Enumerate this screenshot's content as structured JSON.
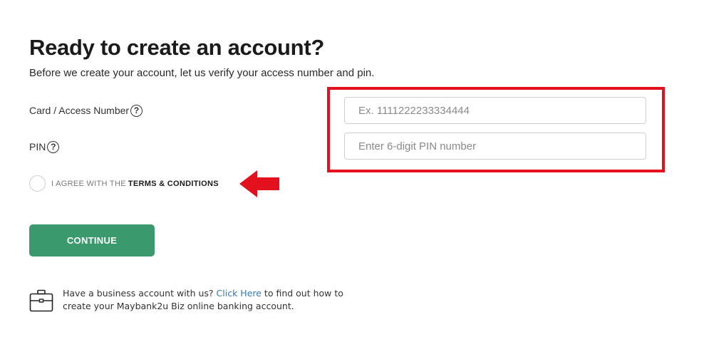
{
  "header": {
    "title": "Ready to create an account?",
    "subtitle": "Before we create your account, let us verify your access number and pin."
  },
  "form": {
    "card_label": "Card / Access Number",
    "card_placeholder": "Ex. 1111222233334444",
    "pin_label": "PIN",
    "pin_placeholder": "Enter 6-digit PIN number",
    "help_symbol": "?",
    "agree_prefix": "I AGREE WITH THE",
    "agree_terms": "TERMS & CONDITIONS",
    "agree_checked": false,
    "continue_label": "CONTINUE"
  },
  "business": {
    "text_before": "Have a business account with us?",
    "link_text": "Click Here",
    "text_after": "to find out how to",
    "text_line2": "create your Maybank2u Biz online banking account."
  },
  "icons": {
    "help": "question-circle-icon",
    "arrow": "arrow-left-icon",
    "briefcase": "briefcase-icon"
  },
  "colors": {
    "accent": "#3a9a6d",
    "highlight": "#e3111d",
    "link": "#3678b8"
  }
}
